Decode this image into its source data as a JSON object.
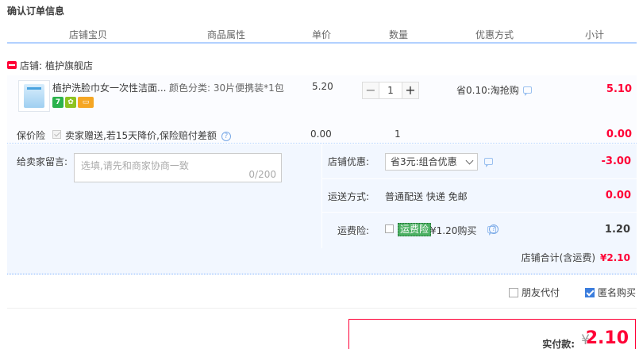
{
  "page": {
    "title": "确认订单信息"
  },
  "columns": [
    "店铺宝贝",
    "商品属性",
    "单价",
    "数量",
    "优惠方式",
    "小计"
  ],
  "shop": {
    "label": "店铺:",
    "name": "植护旗舰店"
  },
  "item": {
    "title": "植护洗脸巾女一次性洁面...",
    "attr": "颜色分类: 30片便携装*1包",
    "price": "5.20",
    "quantity": "1",
    "discount": "省0.10:淘抢购",
    "subtotal": "5.10",
    "badges": [
      "7",
      "✿",
      "▭"
    ]
  },
  "insurance": {
    "label": "保价险",
    "desc": "卖家赠送,若15天降价,保险赔付差额",
    "price": "0.00",
    "qty": "1",
    "total": "0.00"
  },
  "message": {
    "label": "给卖家留言:",
    "placeholder": "选填,请先和商家协商一致",
    "count": "0/200"
  },
  "shop_discount": {
    "label": "店铺优惠:",
    "selected": "省3元:组合优惠",
    "value": "-3.00",
    "color": "#ff0036"
  },
  "shipping": {
    "label": "运送方式:",
    "method": "普通配送 快递 免邮",
    "value": "0.00"
  },
  "freight": {
    "label": "运费险:",
    "tag": "运费险",
    "text": "¥1.20购买",
    "value": "1.20"
  },
  "shop_total": {
    "label": "店铺合计(含运费)",
    "value": "¥2.10"
  },
  "options": {
    "friend_pay": "朋友代付",
    "anonymous": "匿名购买"
  },
  "payment": {
    "label": "实付款:",
    "currency": "¥",
    "amount": "2.10"
  }
}
